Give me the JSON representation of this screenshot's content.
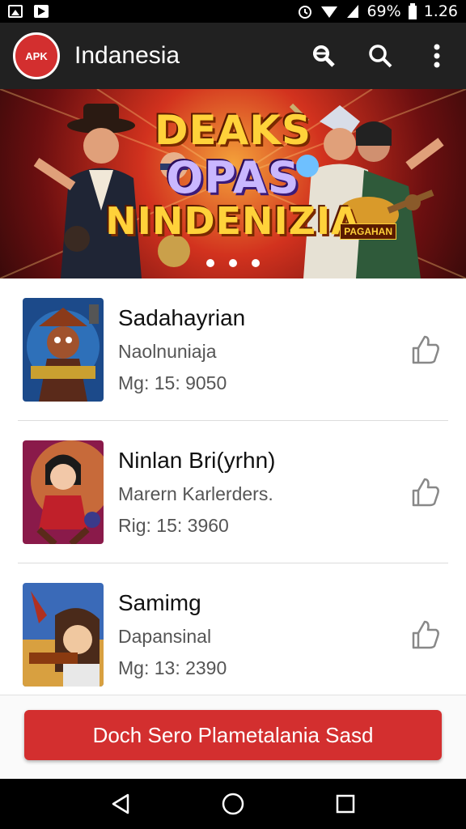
{
  "status_bar": {
    "battery": "69%",
    "time": "1.26",
    "icons": [
      "image-icon",
      "play-store-icon",
      "alarm-icon",
      "wifi-icon",
      "signal-icon",
      "battery-icon"
    ]
  },
  "app_bar": {
    "logo_text": "APK",
    "title": "Indanesia",
    "actions": [
      "search-alt-icon",
      "search-icon",
      "more-vert-icon"
    ]
  },
  "banner": {
    "line1": "DEAKS",
    "line2": "OPAS",
    "line3": "NINDENIZIA",
    "badge": "PAGAHAN",
    "page_count": 3
  },
  "games": [
    {
      "title": "Sadahayrian",
      "subtitle": "Naolnuniaja",
      "meta": "Mg: 15: 9050"
    },
    {
      "title": "Ninlan Bri(yrhn)",
      "subtitle": "Marern Karlerders.",
      "meta": "Rig: 15: 3960"
    },
    {
      "title": "Samimg",
      "subtitle": "Dapansinal",
      "meta": "Mg: 13: 2390"
    }
  ],
  "cta": {
    "label": "Doch Sero Plametalania Sasd"
  },
  "colors": {
    "accent": "#d32f2f",
    "app_bar": "#212121"
  }
}
